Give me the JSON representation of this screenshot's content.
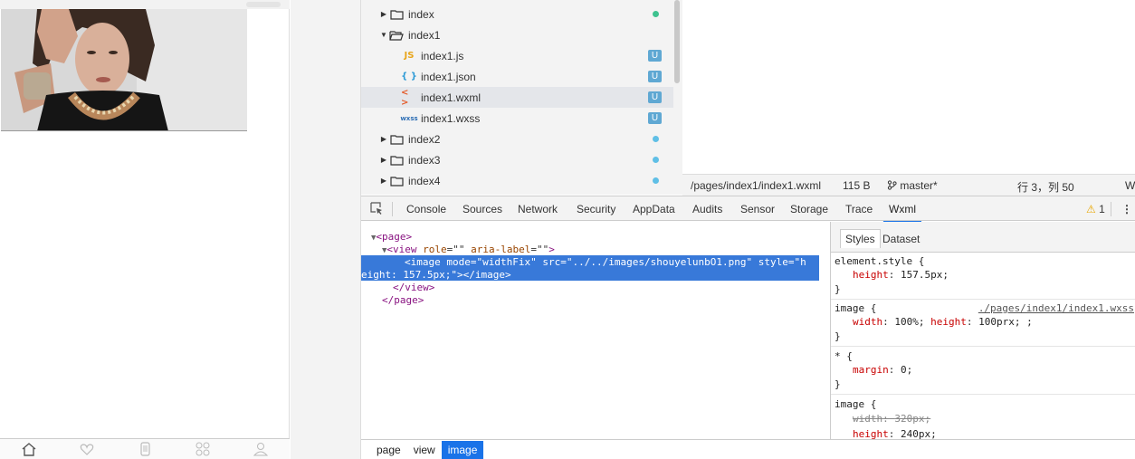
{
  "simulator": {
    "image_alt": "woman portrait photo",
    "tabbar_icons": [
      "home-icon",
      "heart-icon",
      "phone-icon",
      "grid-icon",
      "user-icon"
    ]
  },
  "file_tree": {
    "items": [
      {
        "label": "index",
        "type": "folder",
        "expanded": false,
        "indicator": "dot",
        "dot_color": "#3ec28f"
      },
      {
        "label": "index1",
        "type": "folder",
        "expanded": true,
        "indicator": "none"
      },
      {
        "label": "index1.js",
        "type": "js",
        "icon_text": "JS",
        "indicator": "badge",
        "badge": "U"
      },
      {
        "label": "index1.json",
        "type": "json",
        "icon_text": "{ }",
        "indicator": "badge",
        "badge": "U"
      },
      {
        "label": "index1.wxml",
        "type": "wxml",
        "icon_text": "< >",
        "indicator": "badge",
        "badge": "U",
        "selected": true
      },
      {
        "label": "index1.wxss",
        "type": "wxss",
        "icon_text": "wxss",
        "indicator": "badge",
        "badge": "U"
      },
      {
        "label": "index2",
        "type": "folder",
        "expanded": false,
        "indicator": "dot",
        "dot_color": "#5fbfe6"
      },
      {
        "label": "index3",
        "type": "folder",
        "expanded": false,
        "indicator": "dot",
        "dot_color": "#5fbfe6"
      },
      {
        "label": "index4",
        "type": "folder",
        "expanded": false,
        "indicator": "dot",
        "dot_color": "#5fbfe6"
      }
    ]
  },
  "status_bar": {
    "path": "/pages/index1/index1.wxml",
    "size": "115 B",
    "branch": "master*",
    "position": "行 3，列 50",
    "lang": "W"
  },
  "devtools": {
    "tabs": [
      "Console",
      "Sources",
      "Network",
      "Security",
      "AppData",
      "Audits",
      "Sensor",
      "Storage",
      "Trace",
      "Wxml"
    ],
    "active_tab": "Wxml",
    "warning_count": "1"
  },
  "elements": {
    "page_open": "page",
    "view_tag": "view",
    "view_attrs": [
      {
        "name": "role",
        "value": ""
      },
      {
        "name": "aria-label",
        "value": ""
      }
    ],
    "image_tag": "image",
    "image_attrs": [
      {
        "name": "mode",
        "value": "widthFix"
      },
      {
        "name": "src",
        "value": "../../images/shouyelunbO1.png"
      },
      {
        "name": "style",
        "value": "h"
      }
    ],
    "image_line2_value": "eight: 157.5px;",
    "view_close": "view",
    "page_close": "page"
  },
  "styles": {
    "tabs": [
      "Styles",
      "Dataset"
    ],
    "active_tab": "Styles",
    "rules": [
      {
        "selector": "element.style {",
        "props": [
          {
            "name": "height",
            "value": "157.5px;"
          }
        ]
      },
      {
        "selector": "image {",
        "source": "./pages/index1/index1.wxss",
        "props_text": "width: 100%;  height: 100prx; ;",
        "props": [
          {
            "name": "width",
            "value": "100%;"
          },
          {
            "name": "height",
            "value": "100prx; ;"
          }
        ]
      },
      {
        "selector": "* {",
        "props": [
          {
            "name": "margin",
            "value": "0;"
          }
        ]
      },
      {
        "selector": "image {",
        "props": [
          {
            "name": "width",
            "value": "320px;",
            "struck": true
          },
          {
            "name": "height",
            "value": "240px;"
          }
        ]
      }
    ]
  },
  "breadcrumb": {
    "items": [
      "page",
      "view",
      "image"
    ],
    "active": "image"
  }
}
